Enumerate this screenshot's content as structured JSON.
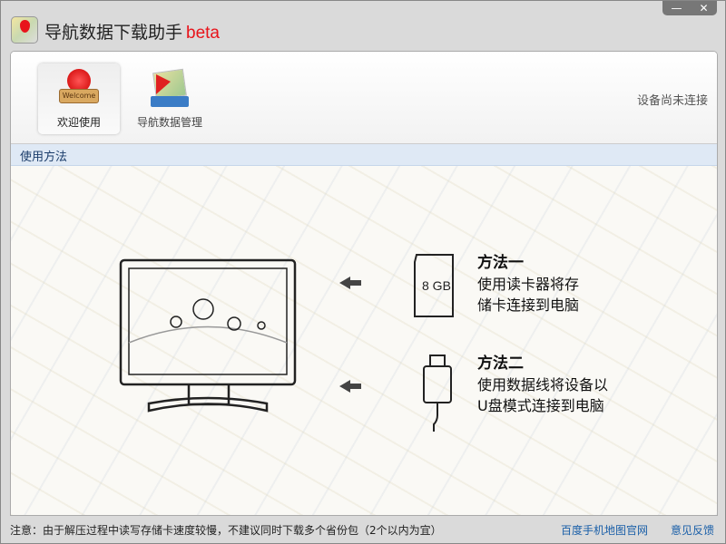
{
  "window": {
    "title": "导航数据下载助手",
    "title_suffix": "beta",
    "minimize": "—",
    "close": "✕"
  },
  "nav": [
    {
      "label": "欢迎使用",
      "icon": "welcome-icon",
      "badge": "Welcome"
    },
    {
      "label": "导航数据管理",
      "icon": "map-data-icon"
    }
  ],
  "status": "设备尚未连接",
  "section_title": "使用方法",
  "method1": {
    "title": "方法一",
    "line1": "使用读卡器将存",
    "line2": "储卡连接到电脑",
    "card_label": "8 GB"
  },
  "method2": {
    "title": "方法二",
    "line1": "使用数据线将设备以",
    "line2": "U盘模式连接到电脑"
  },
  "footer": {
    "notice": "注意：由于解压过程中读写存储卡速度较慢，不建议同时下载多个省份包（2个以内为宜）",
    "link1": "百度手机地图官网",
    "link2": "意见反馈"
  }
}
